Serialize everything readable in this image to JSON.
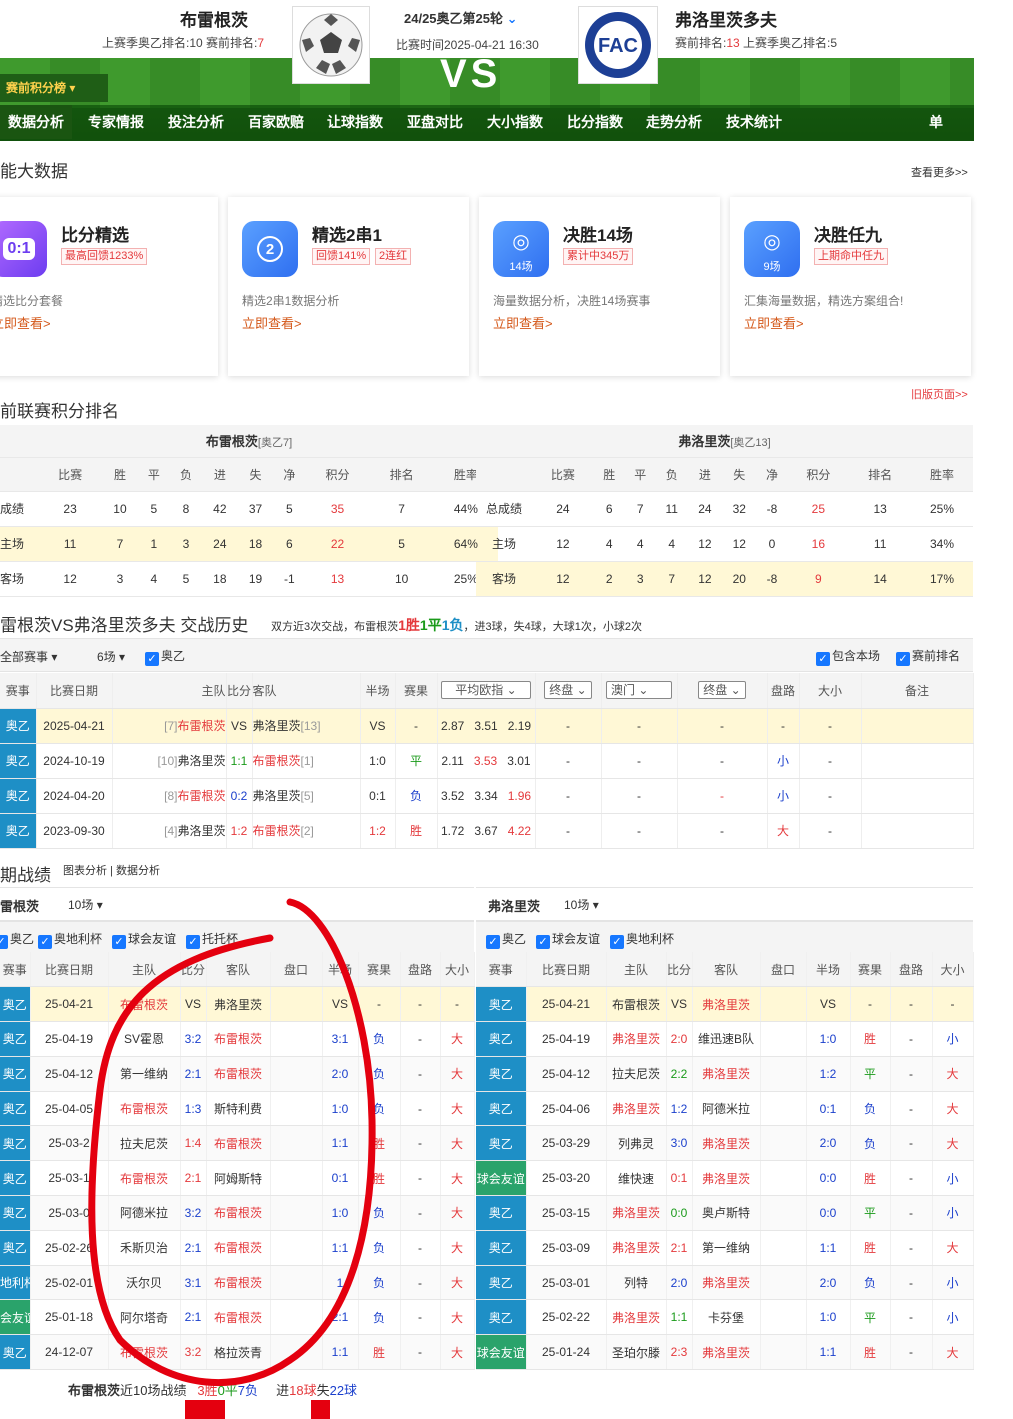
{
  "header": {
    "home": "布雷根茨",
    "home_info_pre": "上赛季奥乙排名:10  赛前排名:",
    "home_rank": "7",
    "away": "弗洛里茨多夫",
    "away_info_pre": "赛前排名:",
    "away_rank": "13",
    "away_info_post": " 上赛季奥乙排名:5",
    "round": "24/25奥乙第25轮",
    "time": "比赛时间2025-04-21 16:30",
    "vs": "VS",
    "rank_btn": "赛前积分榜"
  },
  "nav": [
    "数据分析",
    "专家情报",
    "投注分析",
    "百家欧赔",
    "让球指数",
    "亚盘对比",
    "大小指数",
    "比分指数",
    "走势分析",
    "技术统计"
  ],
  "nav_single": "单场",
  "sec_bigdata": "能大数据",
  "more": "查看更多>>",
  "cards": [
    {
      "title": "比分精选",
      "tag": "最高回馈1233%",
      "desc": "精选比分套餐",
      "link": "立即查看>",
      "icon": "0:1"
    },
    {
      "title": "精选2串1",
      "tag": "回馈141%",
      "tag2": "2连红",
      "desc": "精选2串1数据分析",
      "link": "立即查看>",
      "icon": "2"
    },
    {
      "title": "决胜14场",
      "tag": "累计中345万",
      "desc": "海量数据分析，决胜14场赛事",
      "link": "立即查看>",
      "icon": "14场"
    },
    {
      "title": "决胜任九",
      "tag": "上期命中任九",
      "desc": "汇集海量数据，精选方案组合!",
      "link": "立即查看>",
      "icon": "9场"
    }
  ],
  "sec_rank": "前联赛积分排名",
  "old": "旧版页面>>",
  "rank": {
    "home_title": "布雷根茨",
    "home_sub": "[奥乙7]",
    "away_title": "弗洛里茨",
    "away_sub": "[奥乙13]",
    "cols": [
      "比赛",
      "胜",
      "平",
      "负",
      "进",
      "失",
      "净",
      "积分",
      "排名",
      "胜率"
    ],
    "home": [
      [
        "成绩",
        "23",
        "10",
        "5",
        "8",
        "42",
        "37",
        "5",
        "35",
        "7",
        "44%"
      ],
      [
        "主场",
        "11",
        "7",
        "1",
        "3",
        "24",
        "18",
        "6",
        "22",
        "5",
        "64%"
      ],
      [
        "客场",
        "12",
        "3",
        "4",
        "5",
        "18",
        "19",
        "-1",
        "13",
        "10",
        "25%"
      ]
    ],
    "away": [
      [
        "总成绩",
        "24",
        "6",
        "7",
        "11",
        "24",
        "32",
        "-8",
        "25",
        "13",
        "25%"
      ],
      [
        "主场",
        "12",
        "4",
        "4",
        "4",
        "12",
        "12",
        "0",
        "16",
        "11",
        "34%"
      ],
      [
        "客场",
        "12",
        "2",
        "3",
        "7",
        "12",
        "20",
        "-8",
        "9",
        "14",
        "17%"
      ]
    ]
  },
  "h2h": {
    "title": "雷根茨VS弗洛里茨多夫 交战历史",
    "summary_pre": "双方近3次交战，布雷根茨",
    "w": "1胜",
    "d": "1平",
    "l": "1负",
    "summary_post": "，进3球，失4球，大球1次，小球2次",
    "f_all": "全部赛事",
    "f_n": "6场",
    "f_league": "奥乙",
    "f_inc": "包含本场",
    "f_rank": "赛前排名",
    "cols": [
      "赛事",
      "比赛日期",
      "主队",
      "比分",
      "客队",
      "半场",
      "赛果",
      "平均欧指",
      "终盘",
      "澳门",
      "终盘",
      "盘路",
      "大小",
      "备注"
    ],
    "rows": [
      [
        "奥乙",
        "2025-04-21",
        "[7]",
        "布雷根茨",
        "VS",
        "弗洛里茨",
        "[13]",
        "VS",
        "-",
        "2.87",
        "3.51",
        "2.19",
        "-",
        "-",
        "-",
        "-",
        ""
      ],
      [
        "奥乙",
        "2024-10-19",
        "[10]",
        "弗洛里茨",
        "1:1",
        "布雷根茨",
        "[1]",
        "1:0",
        "平",
        "2.11",
        "3.53",
        "3.01",
        "-",
        "-",
        "-",
        "小",
        "-"
      ],
      [
        "奥乙",
        "2024-04-20",
        "[8]",
        "布雷根茨",
        "0:2",
        "弗洛里茨",
        "[5]",
        "0:1",
        "负",
        "3.52",
        "3.34",
        "1.96",
        "-",
        "-",
        "-",
        "小",
        "-"
      ],
      [
        "奥乙",
        "2023-09-30",
        "[4]",
        "弗洛里茨",
        "1:2",
        "布雷根茨",
        "[2]",
        "1:2",
        "胜",
        "1.72",
        "3.67",
        "4.22",
        "-",
        "-",
        "-",
        "大",
        "-"
      ]
    ]
  },
  "recent": {
    "title": "期战绩",
    "links": "图表分析 | 数据分析",
    "home_name": "雷根茨",
    "home_n": "10场",
    "away_name": "弗洛里茨",
    "away_n": "10场",
    "home_f": [
      "奥乙",
      "奥地利杯",
      "球会友谊",
      "托托杯"
    ],
    "away_f": [
      "奥乙",
      "球会友谊",
      "奥地利杯"
    ],
    "cols": [
      "赛事",
      "比赛日期",
      "主队",
      "比分",
      "客队",
      "盘口",
      "半场",
      "赛果",
      "盘路",
      "大小"
    ],
    "home_rows": [
      [
        "奥乙",
        "25-04-21",
        "布雷根茨",
        "VS",
        "弗洛里茨",
        "",
        "VS",
        "-",
        "-",
        "-"
      ],
      [
        "奥乙",
        "25-04-19",
        "SV霍恩",
        "3:2",
        "布雷根茨",
        "",
        "3:1",
        "负",
        "-",
        "大"
      ],
      [
        "奥乙",
        "25-04-12",
        "第一维纳",
        "2:1",
        "布雷根茨",
        "",
        "2:0",
        "负",
        "-",
        "大"
      ],
      [
        "奥乙",
        "25-04-05",
        "布雷根茨",
        "1:3",
        "斯特利费",
        "",
        "1:0",
        "负",
        "-",
        "大"
      ],
      [
        "奥乙",
        "25-03-2",
        "拉夫尼茨",
        "1:4",
        "布雷根茨",
        "",
        "1:1",
        "胜",
        "-",
        "大"
      ],
      [
        "奥乙",
        "25-03-1",
        "布雷根茨",
        "2:1",
        "阿姆斯特",
        "",
        "0:1",
        "胜",
        "-",
        "大"
      ],
      [
        "奥乙",
        "25-03-0",
        "阿德米拉",
        "3:2",
        "布雷根茨",
        "",
        "1:0",
        "负",
        "-",
        "大"
      ],
      [
        "奥乙",
        "25-02-26",
        "禾斯贝治",
        "2:1",
        "布雷根茨",
        "",
        "1:1",
        "负",
        "-",
        "大"
      ],
      [
        "地利杯",
        "25-02-01",
        "沃尔贝",
        "3:1",
        "布雷根茨",
        "",
        "1",
        "负",
        "-",
        "大"
      ],
      [
        "会友谊",
        "25-01-18",
        "阿尔塔奇",
        "2:1",
        "布雷根茨",
        "",
        "2:1",
        "负",
        "-",
        "大"
      ],
      [
        "奥乙",
        "24-12-07",
        "布雷根茨",
        "3:2",
        "格拉茨青",
        "",
        "1:1",
        "胜",
        "-",
        "大"
      ]
    ],
    "away_rows": [
      [
        "奥乙",
        "25-04-21",
        "布雷根茨",
        "VS",
        "弗洛里茨",
        "",
        "VS",
        "-",
        "-",
        "-"
      ],
      [
        "奥乙",
        "25-04-19",
        "弗洛里茨",
        "2:0",
        "维迅速B队",
        "",
        "1:0",
        "胜",
        "-",
        "小"
      ],
      [
        "奥乙",
        "25-04-12",
        "拉夫尼茨",
        "2:2",
        "弗洛里茨",
        "",
        "1:2",
        "平",
        "-",
        "大"
      ],
      [
        "奥乙",
        "25-04-06",
        "弗洛里茨",
        "1:2",
        "阿德米拉",
        "",
        "0:1",
        "负",
        "-",
        "大"
      ],
      [
        "奥乙",
        "25-03-29",
        "列弗灵",
        "3:0",
        "弗洛里茨",
        "",
        "2:0",
        "负",
        "-",
        "大"
      ],
      [
        "球会友谊",
        "25-03-20",
        "维快速",
        "0:1",
        "弗洛里茨",
        "",
        "0:0",
        "胜",
        "-",
        "小"
      ],
      [
        "奥乙",
        "25-03-15",
        "弗洛里茨",
        "0:0",
        "奥卢斯特",
        "",
        "0:0",
        "平",
        "-",
        "小"
      ],
      [
        "奥乙",
        "25-03-09",
        "弗洛里茨",
        "2:1",
        "第一维纳",
        "",
        "1:1",
        "胜",
        "-",
        "大"
      ],
      [
        "奥乙",
        "25-03-01",
        "列特",
        "2:0",
        "弗洛里茨",
        "",
        "2:0",
        "负",
        "-",
        "小"
      ],
      [
        "奥乙",
        "25-02-22",
        "弗洛里茨",
        "1:1",
        "卡芬堡",
        "",
        "1:0",
        "平",
        "-",
        "小"
      ],
      [
        "球会友谊",
        "25-01-24",
        "圣珀尔滕",
        "2:3",
        "弗洛里茨",
        "",
        "1:1",
        "胜",
        "-",
        "大"
      ]
    ],
    "home_sum_name": "布雷根茨",
    "home_sum_pre": "近10场战绩",
    "home_sum_w": "3胜",
    "home_sum_d": "0平",
    "home_sum_l": "7负",
    "home_sum_in_pre": "进",
    "home_sum_in": "18球",
    "home_sum_out_pre": "失",
    "home_sum_out": "22球"
  }
}
